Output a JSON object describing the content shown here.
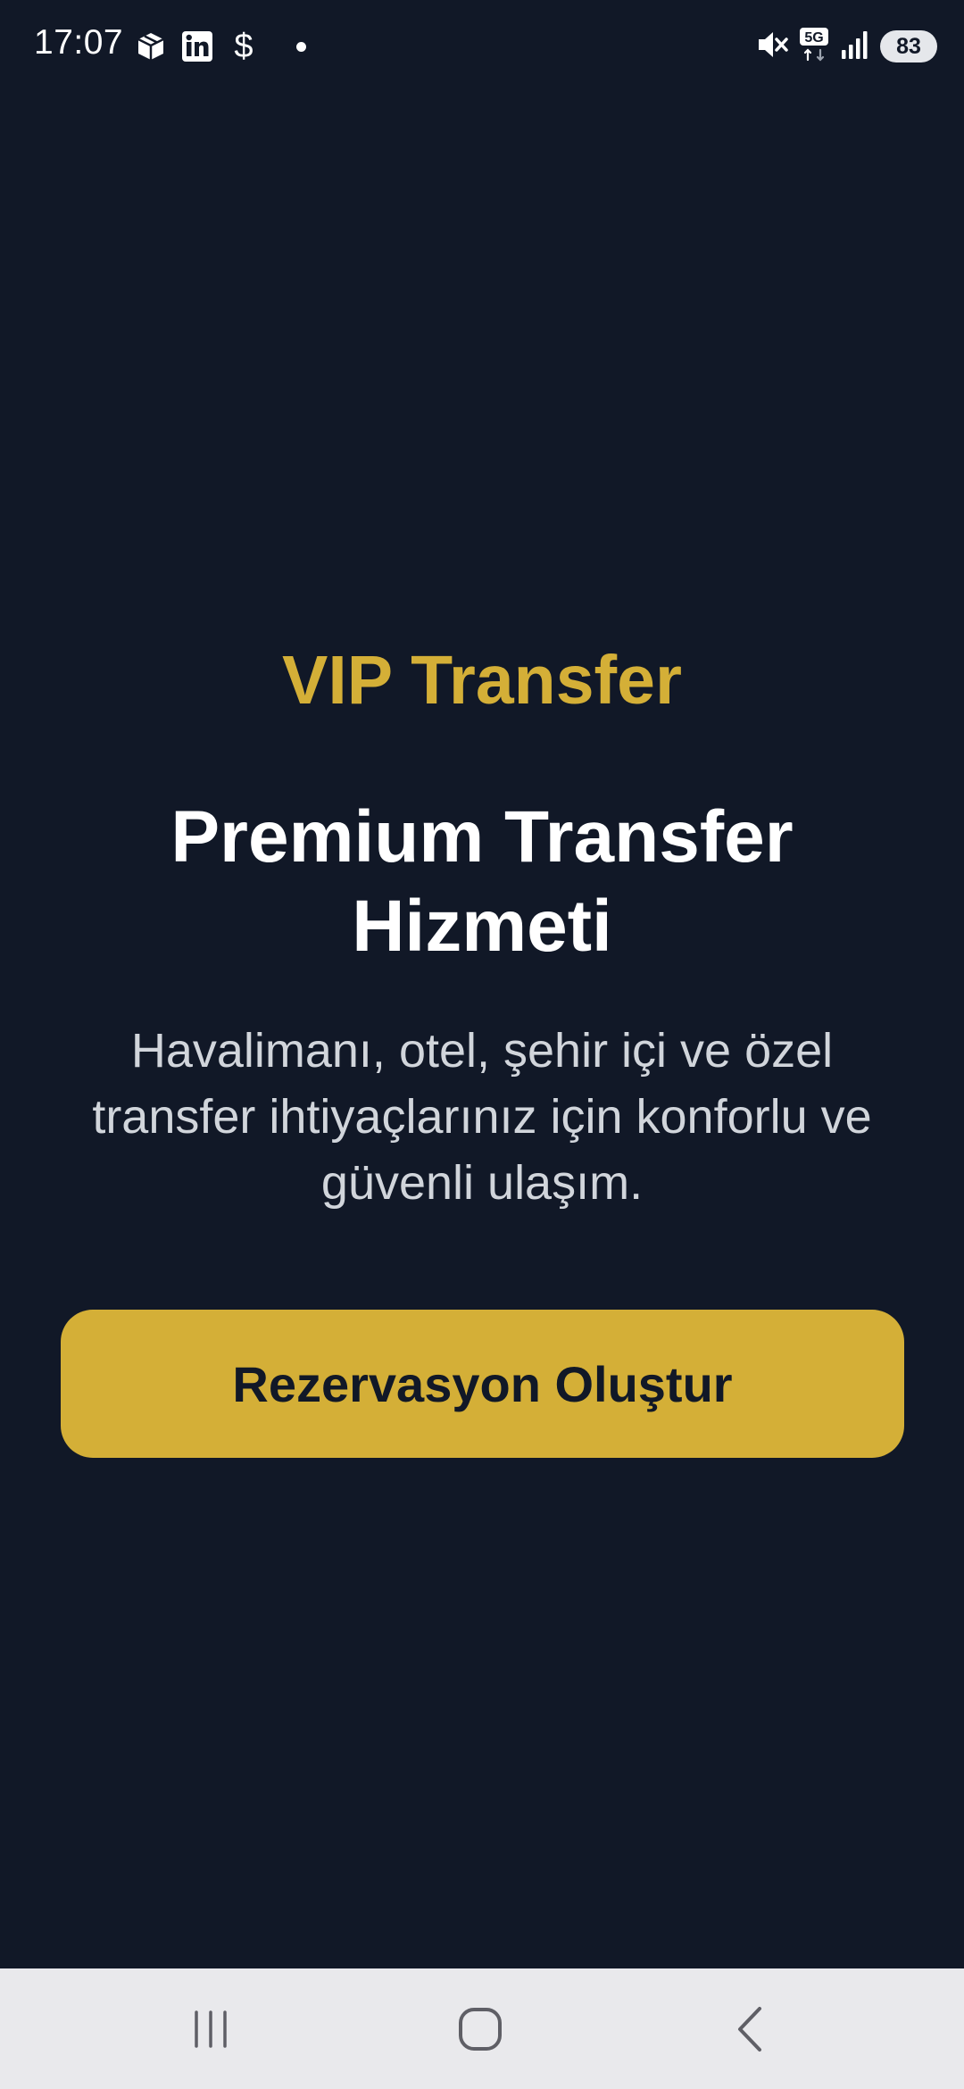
{
  "status_bar": {
    "time": "17:07",
    "left_icons": [
      "package-icon",
      "linkedin-icon",
      "dollar-icon",
      "notification-dot"
    ],
    "dollar_glyph": "$",
    "right_icons": [
      "mute-icon",
      "5g-icon",
      "signal-icon",
      "battery-icon"
    ],
    "network_label": "5G",
    "battery_level": "83"
  },
  "hero": {
    "brand": "VIP Transfer",
    "headline": "Premium Transfer Hizmeti",
    "subtitle": "Havalimanı, otel, şehir içi ve özel transfer ihtiyaçlarınız için konforlu ve güvenli ulaşım.",
    "cta_label": "Rezervasyon Oluştur"
  },
  "colors": {
    "background": "#111827",
    "accent": "#d4af37",
    "heading": "#ffffff",
    "body_text": "#d1d5db",
    "nav_bar": "#e9e9ec"
  },
  "nav_bar": {
    "buttons": [
      "recents-icon",
      "home-icon",
      "back-icon"
    ]
  }
}
